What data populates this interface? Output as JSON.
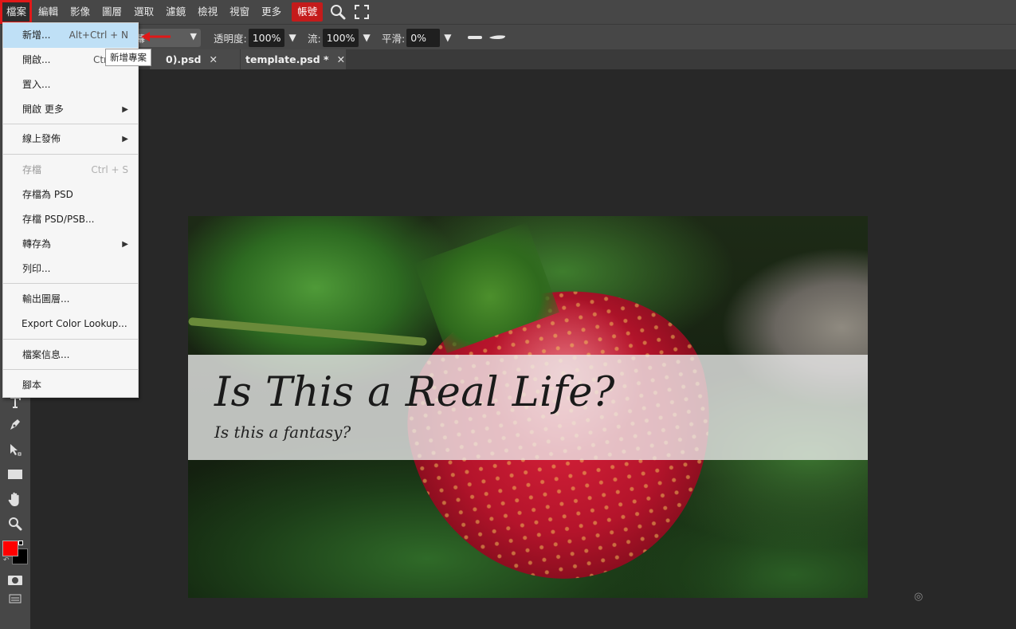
{
  "menubar": {
    "items": [
      "檔案",
      "編輯",
      "影像",
      "圖層",
      "選取",
      "濾鏡",
      "檢視",
      "視窗",
      "更多"
    ],
    "account_label": "帳號",
    "search_icon": "search-icon",
    "fullscreen_icon": "fullscreen-icon"
  },
  "options": {
    "blend_value": "幕",
    "opacity_label": "透明度:",
    "opacity_value": "100%",
    "flow_label": "流:",
    "flow_value": "100%",
    "smooth_label": "平滑:",
    "smooth_value": "0%",
    "dropdown_glyph": "▼"
  },
  "tabs": [
    {
      "label": "0).psd",
      "close": "✕"
    },
    {
      "label": "template.psd *",
      "close": "✕"
    }
  ],
  "file_menu": {
    "new": {
      "label": "新增...",
      "shortcut": "Alt+Ctrl + N"
    },
    "open": {
      "label": "開啟...",
      "shortcut": "Ctr"
    },
    "place": {
      "label": "置入..."
    },
    "open_more": {
      "label": "開啟 更多"
    },
    "publish": {
      "label": "線上發佈"
    },
    "save": {
      "label": "存檔",
      "shortcut": "Ctrl + S"
    },
    "save_psd": {
      "label": "存檔為 PSD"
    },
    "save_psd_psb": {
      "label": "存檔 PSD/PSB..."
    },
    "export_as": {
      "label": "轉存為"
    },
    "print": {
      "label": "列印..."
    },
    "export_layers": {
      "label": "輸出圖層..."
    },
    "export_lut": {
      "label": "Export Color Lookup..."
    },
    "file_info": {
      "label": "檔案信息..."
    },
    "script": {
      "label": "腳本"
    },
    "submenu_arrow": "▶"
  },
  "tooltip": "新增專案",
  "canvas": {
    "headline": "Is This a Real Life?",
    "subline": "Is this a fantasy?"
  },
  "colors": {
    "foreground": "#ff0000",
    "background": "#000000",
    "accent": "#c41b1b",
    "highlight": "#e11919",
    "menu_hover": "#bfe0f6"
  },
  "corner_glyph": "◎"
}
